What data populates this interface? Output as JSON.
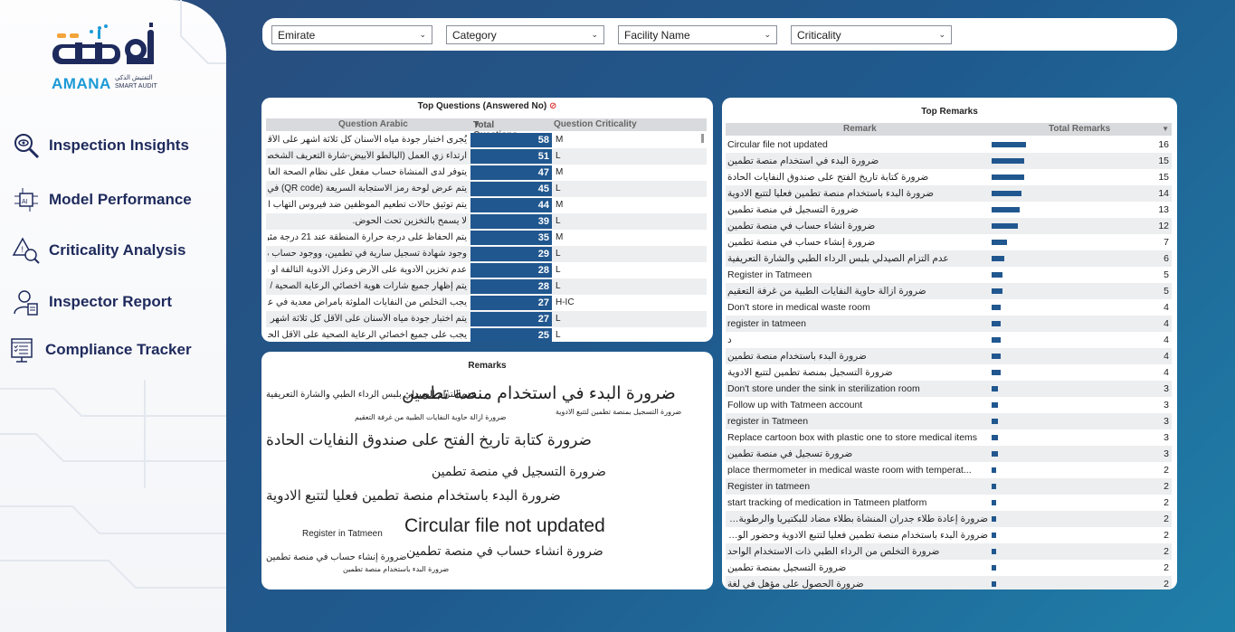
{
  "app": {
    "logo_en": "AMANA",
    "logo_sub_ar": "التفتيش الذكي",
    "logo_sub_en": "SMART AUDIT",
    "logo_ar": "أمانة"
  },
  "nav": [
    {
      "label": "Inspection Insights",
      "icon": "magnifier-eye-icon"
    },
    {
      "label": "Model Performance",
      "icon": "ai-chip-icon"
    },
    {
      "label": "Criticality Analysis",
      "icon": "warning-search-icon"
    },
    {
      "label": "Inspector Report",
      "icon": "inspector-user-icon"
    },
    {
      "label": "Compliance Tracker",
      "icon": "checklist-screen-icon"
    }
  ],
  "filters": [
    "Emirate",
    "Category",
    "Facility Name",
    "Criticality"
  ],
  "top_questions": {
    "title": "Top Questions (Answered No)",
    "title_icon": "no-entry-icon",
    "columns": [
      "Question Arabic",
      "Total Questions",
      "Question Criticality"
    ],
    "sort_indicator": "▼",
    "rows": [
      {
        "q": "يُجرى اختبار جودة مياه الأسنان كل ثلاثة أشهر على الأقل ويتم...",
        "n": "58",
        "c": "M"
      },
      {
        "q": "ارتداء زي العمل (البالطو الأبيض-شارة التعريف الشخصي).",
        "n": "51",
        "c": "L"
      },
      {
        "q": "يتوفر لدى المنشأة حساب مفعل على نظام الصحة العامة ( SP...",
        "n": "47",
        "c": "M"
      },
      {
        "q": "يتم عرض لوحة رمز الاستجابة السريعة (QR code) في مكا...",
        "n": "45",
        "c": "L"
      },
      {
        "q": "يتم توثيق حالات تطعيم الموظفين ضد فيروس التهاب الكبد ب.",
        "n": "44",
        "c": "M"
      },
      {
        "q": "لا يسمح بالتخزين تحت الحوض.",
        "n": "39",
        "c": "L"
      },
      {
        "q": "يتم الحفاظ على درجة حرارة المنطقة عند 21 درجة مئوية إلى...",
        "n": "35",
        "c": "M"
      },
      {
        "q": "وجود شهادة تسجيل سارية في تطمين، ووجود حساب مستخدم...",
        "n": "29",
        "c": "L"
      },
      {
        "q": "عدم تخزين الأدوية على الأرض وعزل الأدوية التالفة أو منتهية...",
        "n": "28",
        "c": "L"
      },
      {
        "q": "يتم إظهار جميع شارات هوية أخصائي الرعاية الصحية / ترخ...",
        "n": "28",
        "c": "L"
      },
      {
        "q": "يجب التخلص من النفايات الملوثة بأمراض معدية في عصون...",
        "n": "27",
        "c": "H-IC"
      },
      {
        "q": "يتم اختبار جودة مياه الأسنان على الأقل كل ثلاثة أشهر ويتم ال...",
        "n": "27",
        "c": "L"
      },
      {
        "q": "يجب على جميع أخصائي الرعاية الصحية على الأقل الحفاظ...",
        "n": "25",
        "c": "L"
      }
    ]
  },
  "remarks_cloud": {
    "title": "Remarks",
    "words": [
      {
        "t": "ضرورة البدء في استخدام منصة تطمين",
        "s": 19
      },
      {
        "t": "عدم التزام الصيدلي بلبس الرداء الطبي والشارة التعريفية",
        "s": 10
      },
      {
        "t": "ضرورة ازالة حاوية النفايات الطبية من غرفة التعقيم",
        "s": 8
      },
      {
        "t": "ضرورة التسجيل بمنصة تطمين لتتبع الادوية",
        "s": 8
      },
      {
        "t": "ضرورة كتابة تاريخ الفتح على صندوق النفايات الحادة",
        "s": 17
      },
      {
        "t": "ضرورة التسجيل في منصة تطمين",
        "s": 14
      },
      {
        "t": "ضرورة البدء باستخدام منصة تطمين فعليا لتتبع الادوية",
        "s": 15
      },
      {
        "t": "Circular file not updated",
        "s": 21
      },
      {
        "t": "Register in Tatmeen",
        "s": 10
      },
      {
        "t": "ضرورة إنشاء حساب في منصة تطمين",
        "s": 10
      },
      {
        "t": "ضرورة انشاء حساب في منصة تطمين",
        "s": 14
      },
      {
        "t": "ضرورة البدء باستخدام منصة تطمين",
        "s": 8
      }
    ]
  },
  "top_remarks": {
    "title": "Top Remarks",
    "columns": [
      "Remark",
      "Total Remarks"
    ],
    "sort_indicator": "▼",
    "rows": [
      {
        "r": "Circular file not updated",
        "n": 16
      },
      {
        "r": "ضرورة البدء في استخدام منصة تطمين",
        "n": 15
      },
      {
        "r": "ضرورة كتابة تاريخ الفتح على صندوق النفايات الحادة",
        "n": 15
      },
      {
        "r": "ضرورة البدء باستخدام منصة تطمين فعليا لتتبع الادوية",
        "n": 14
      },
      {
        "r": "ضرورة التسجيل في منصة تطمين",
        "n": 13
      },
      {
        "r": "ضرورة انشاء حساب في منصة تطمين",
        "n": 12
      },
      {
        "r": "ضرورة إنشاء حساب في منصة تطمين",
        "n": 7
      },
      {
        "r": "عدم التزام الصيدلي بلبس الرداء الطبي والشارة التعريفية",
        "n": 6
      },
      {
        "r": "Register in Tatmeen",
        "n": 5
      },
      {
        "r": "ضرورة ازالة حاوية النفايات الطبية من غرفة التعقيم",
        "n": 5
      },
      {
        "r": "Don't store in medical waste room",
        "n": 4
      },
      {
        "r": "register in tatmeen",
        "n": 4
      },
      {
        "r": "د",
        "n": 4
      },
      {
        "r": "ضرورة البدء باستخدام منصة تطمين",
        "n": 4
      },
      {
        "r": "ضرورة التسجيل بمنصة تطمين لتتبع الادوية",
        "n": 4
      },
      {
        "r": "Don't store under the sink in sterilization room",
        "n": 3
      },
      {
        "r": "Follow up with Tatmeen account",
        "n": 3
      },
      {
        "r": "register in Tatmeen",
        "n": 3
      },
      {
        "r": "Replace cartoon box with plastic one to store medical items",
        "n": 3
      },
      {
        "r": "ضرورة تسجيل في منصة تطمين",
        "n": 3
      },
      {
        "r": "place thermometer in medical waste room with temperat...",
        "n": 2
      },
      {
        "r": "Register in tatmeen",
        "n": 2
      },
      {
        "r": "start tracking of medication in Tatmeen platform",
        "n": 2
      },
      {
        "r": "ضرورة إعادة طلاء جدران المنشأة بطلاء مضاد للبكتيريا والرطوبة والحرائق في...",
        "n": 2
      },
      {
        "r": "ضرورة البدء باستخدام منصة تطمين فعليا لتتبع الادوية وحضور الورشات التدريبية...",
        "n": 2
      },
      {
        "r": "ضرورة التخلص من الرداء الطبي ذات الاستخدام الواحد",
        "n": 2
      },
      {
        "r": "ضرورة التسجيل بمنصة تطمين",
        "n": 2
      },
      {
        "r": "ضرورة الحصول على مؤهل في لغة",
        "n": 2
      }
    ]
  },
  "colors": {
    "accent": "#21578f",
    "sidebar_text": "#1e2a5c",
    "brand_blue": "#1b9ad6"
  }
}
